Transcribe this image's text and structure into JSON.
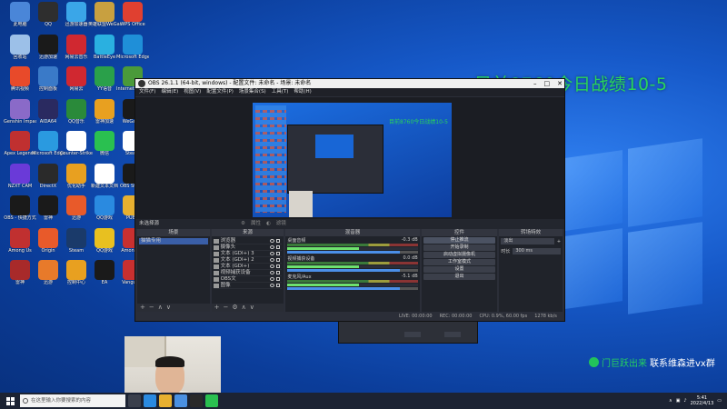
{
  "overlay": {
    "title": "目前8760今日战绩10-5",
    "wechat_green": "门巨跃出来",
    "wechat_white": "联系维森进vx群"
  },
  "desktop_icons": [
    {
      "label": "此电脑",
      "color": "#4a86d8"
    },
    {
      "label": "QQ",
      "color": "#2e2e2e"
    },
    {
      "label": "迅游加速器",
      "color": "#3aa6e8"
    },
    {
      "label": "英雄联盟WeGame版",
      "color": "#c8a040"
    },
    {
      "label": "WPS Office",
      "color": "#e04030"
    },
    {
      "label": "回收站",
      "color": "#9cc0e8"
    },
    {
      "label": "迅游加速",
      "color": "#1a1a1a"
    },
    {
      "label": "网易云音乐",
      "color": "#d02830"
    },
    {
      "label": "BattleEye",
      "color": "#2ab0e0"
    },
    {
      "label": "Microsoft Edge",
      "color": "#1f8fd8"
    },
    {
      "label": "腾讯视频",
      "color": "#e84a2a"
    },
    {
      "label": "控制面板",
      "color": "#3a7ac8"
    },
    {
      "label": "网易云",
      "color": "#d02830"
    },
    {
      "label": "YY语音",
      "color": "#2aa04a"
    },
    {
      "label": "Internet Download",
      "color": "#4a9a3a"
    },
    {
      "label": "Genshin Impact",
      "color": "#8a6ac8"
    },
    {
      "label": "AIDA64",
      "color": "#2a2a60"
    },
    {
      "label": "QQ音乐",
      "color": "#2a8a3a"
    },
    {
      "label": "雷神加速",
      "color": "#e8a020"
    },
    {
      "label": "WeGame",
      "color": "#1a1a1a"
    },
    {
      "label": "Apex Legends",
      "color": "#c03030"
    },
    {
      "label": "Microsoft Edge",
      "color": "#2a9ae0"
    },
    {
      "label": "Counter-Strike",
      "color": "#ffffff"
    },
    {
      "label": "微信",
      "color": "#2ac050"
    },
    {
      "label": "Steam",
      "color": "#ffffff"
    },
    {
      "label": "NZXT CAM",
      "color": "#6a3ad8"
    },
    {
      "label": "DirectX",
      "color": "#2a2a2a"
    },
    {
      "label": "优化助手",
      "color": "#e8a020"
    },
    {
      "label": "新建文本文档",
      "color": "#ffffff"
    },
    {
      "label": "OBS Studio",
      "color": "#1a1a1a"
    },
    {
      "label": "OBS - 快捷方式",
      "color": "#1a1a1a"
    },
    {
      "label": "雷神",
      "color": "#1a1a1a"
    },
    {
      "label": "迅游",
      "color": "#e85a2a"
    },
    {
      "label": "QQ游戏",
      "color": "#2a8ae0"
    },
    {
      "label": "PUBG",
      "color": "#e8b030"
    },
    {
      "label": "Among Us",
      "color": "#c03030"
    },
    {
      "label": "Origin",
      "color": "#e85a2a"
    },
    {
      "label": "Steam",
      "color": "#1a3a6a"
    },
    {
      "label": "QQ游戏",
      "color": "#e8c020"
    },
    {
      "label": "Among Us",
      "color": "#c83030"
    },
    {
      "label": "雷神",
      "color": "#a82a2a"
    },
    {
      "label": "迅游",
      "color": "#e87a2a"
    },
    {
      "label": "控制中心",
      "color": "#e8a020"
    },
    {
      "label": "EA",
      "color": "#1a1a1a"
    },
    {
      "label": "Vanguard",
      "color": "#c83030"
    }
  ],
  "obs": {
    "title": "OBS 26.1.1 (64-bit, windows) - 配置文件: 未命名 - 场景: 未命名",
    "menu": [
      "文件(F)",
      "编辑(E)",
      "视图(V)",
      "配置文件(P)",
      "场景集合(S)",
      "工具(T)",
      "帮助(H)"
    ],
    "selected_source": "未选择源",
    "props_btn": "属性",
    "filters_btn": "滤镜",
    "scenes_title": "场景",
    "scene_item": "猫猫专用",
    "sources_title": "来源",
    "sources": [
      "浏览器",
      "摄像头",
      "文本 (GDI+) 3",
      "文本 (GDI+) 2",
      "文本 (GDI+)",
      "视频捕获设备",
      "OBS文",
      "图像"
    ],
    "mixer_title": "混音器",
    "mixer": [
      {
        "name": "桌面音频",
        "db": "-0.3 dB"
      },
      {
        "name": "视频捕获设备",
        "db": "0.0 dB"
      },
      {
        "name": "麦克风/Aux",
        "db": "-5.1 dB"
      }
    ],
    "controls_title": "控件",
    "controls": [
      "停止推流",
      "开始录制",
      "启动虚拟摄像机",
      "工作室模式",
      "设置",
      "退出"
    ],
    "transitions_title": "转场特效",
    "transition": "淡出",
    "duration_label": "时长",
    "duration_value": "300 ms",
    "status": [
      "LIVE: 00:00:00",
      "REC: 00:00:00",
      "CPU: 0.9%, 60.00 fps",
      "1278 kb/s"
    ]
  },
  "taskbar": {
    "search_placeholder": "在这里输入你要搜索的内容",
    "time": "5:41",
    "date": "2022/4/13"
  }
}
